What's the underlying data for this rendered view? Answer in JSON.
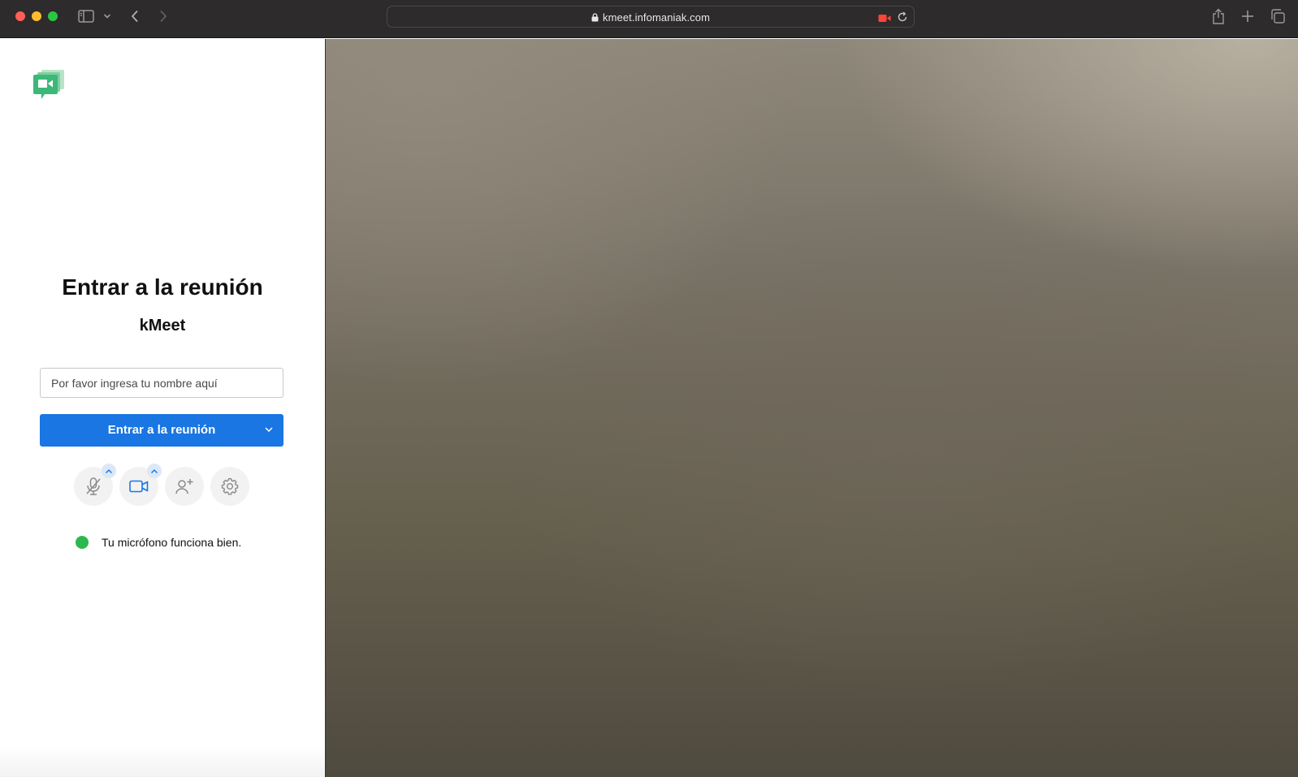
{
  "browser": {
    "url": "kmeet.infomaniak.com"
  },
  "join": {
    "title": "Entrar a la reunión",
    "room_name": "kMeet",
    "name_placeholder": "Por favor ingresa tu nombre aquí",
    "name_value": "",
    "button_label": "Entrar a la reunión"
  },
  "controls": [
    {
      "name": "microphone",
      "icon": "microphone-muted-icon",
      "has_menu": true
    },
    {
      "name": "camera",
      "icon": "video-camera-icon",
      "has_menu": true
    },
    {
      "name": "invite",
      "icon": "add-person-icon",
      "has_menu": false
    },
    {
      "name": "settings",
      "icon": "gear-icon",
      "has_menu": false
    }
  ],
  "status": {
    "text": "Tu micrófono funciona bien.",
    "color": "#2db84d"
  },
  "colors": {
    "primary": "#1976e3",
    "brand_green": "#3cb878"
  }
}
